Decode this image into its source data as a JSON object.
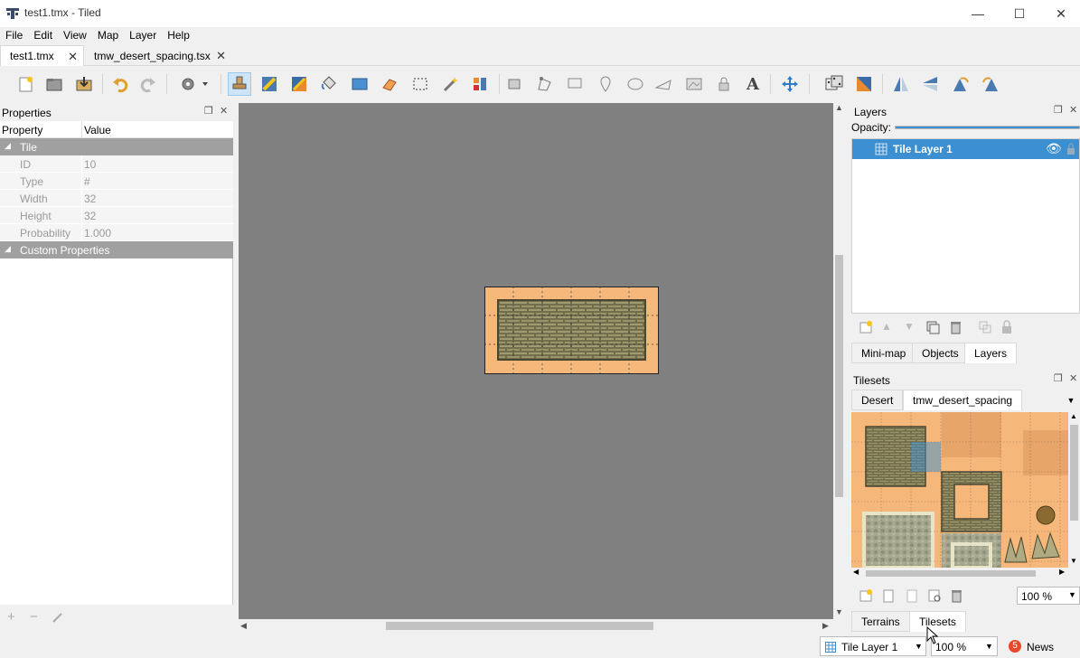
{
  "window": {
    "title": "test1.tmx - Tiled",
    "minimize_glyph": "—",
    "maximize_glyph": "☐",
    "close_glyph": "✕"
  },
  "menu": [
    "File",
    "Edit",
    "View",
    "Map",
    "Layer",
    "Help"
  ],
  "doc_tabs": [
    {
      "label": "test1.tmx",
      "active": true
    },
    {
      "label": "tmw_desert_spacing.tsx",
      "active": false
    }
  ],
  "toolbar": {
    "icons": [
      "new-map-icon",
      "open-icon",
      "save-icon",
      "undo-icon",
      "redo-icon",
      "commands-icon",
      "stamp-brush-icon",
      "terrain-brush-icon",
      "wang-brush-icon",
      "bucket-fill-icon",
      "shape-fill-icon",
      "eraser-icon",
      "rect-select-icon",
      "magic-wand-icon",
      "select-same-tile-icon",
      "object-select-icon",
      "edit-polygon-icon",
      "insert-rectangle-icon",
      "insert-point-icon",
      "insert-ellipse-icon",
      "insert-polygon-icon",
      "insert-tile-icon",
      "insert-template-icon",
      "insert-text-icon",
      "move-icon",
      "random-mode-icon",
      "wang-fill-icon",
      "flip-horizontal-icon",
      "flip-vertical-icon",
      "rotate-left-icon",
      "rotate-right-icon"
    ]
  },
  "properties": {
    "title": "Properties",
    "col_property": "Property",
    "col_value": "Value",
    "group_tile": "Tile",
    "rows": [
      {
        "key": "ID",
        "value": "10"
      },
      {
        "key": "Type",
        "value": "#"
      },
      {
        "key": "Width",
        "value": "32"
      },
      {
        "key": "Height",
        "value": "32"
      },
      {
        "key": "Probability",
        "value": "1.000"
      }
    ],
    "group_custom": "Custom Properties"
  },
  "layers_panel": {
    "title": "Layers",
    "opacity_label": "Opacity:",
    "opacity": 1.0,
    "layers": [
      {
        "name": "Tile Layer 1",
        "selected": true
      }
    ],
    "tabs": [
      "Mini-map",
      "Objects",
      "Layers"
    ],
    "active_tab": "Layers"
  },
  "tilesets_panel": {
    "title": "Tilesets",
    "tabs": [
      "Desert",
      "tmw_desert_spacing"
    ],
    "active_tab": "tmw_desert_spacing",
    "zoom": "100 %",
    "bottom_tabs": [
      "Terrains",
      "Tilesets"
    ],
    "active_bottom_tab": "Tilesets"
  },
  "statusbar": {
    "layer_select": "Tile Layer 1",
    "zoom": "100 %",
    "news_count": "5",
    "news_label": "News"
  },
  "colors": {
    "selection": "#3c8fd0",
    "canvas_bg": "#808080",
    "sand": "#f5b77a",
    "news_badge": "#e8492a"
  }
}
